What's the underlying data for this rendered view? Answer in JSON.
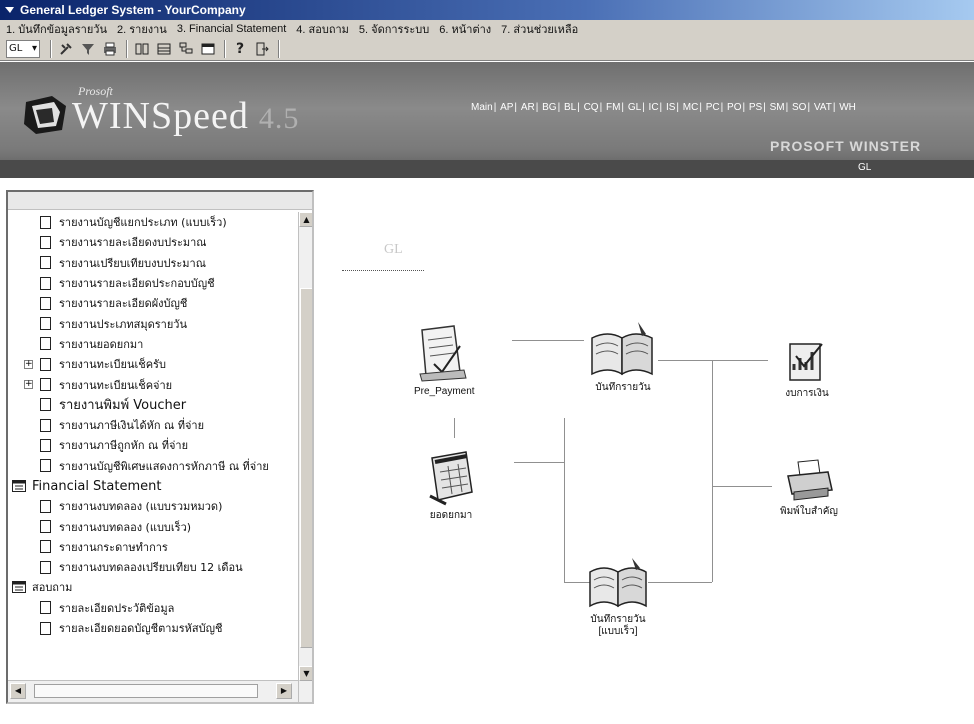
{
  "window": {
    "title": "General Ledger System - YourCompany"
  },
  "menu": [
    "1. บันทึกข้อมูลรายวัน",
    "2. รายงาน",
    "3. Financial Statement",
    "4. สอบถาม",
    "5. จัดการระบบ",
    "6. หน้าต่าง",
    "7. ส่วนช่วยเหลือ"
  ],
  "toolbar": {
    "module_value": "GL",
    "icons": [
      "tools-icon",
      "filter-icon",
      "print-icon",
      "columns-icon",
      "rows-icon",
      "tree-icon",
      "window-icon",
      "help-icon",
      "exit-icon"
    ]
  },
  "banner": {
    "brand_small": "Prosoft",
    "product": "WINSpeed",
    "version": "4.5",
    "modules": [
      "Main",
      "AP",
      "AR",
      "BG",
      "BL",
      "CQ",
      "FM",
      "GL",
      "IC",
      "IS",
      "MC",
      "PC",
      "PO",
      "PS",
      "SM",
      "SO",
      "VAT",
      "WH"
    ],
    "tagline": "PROSOFT WINSTER",
    "current_module": "GL"
  },
  "tree": {
    "items": [
      {
        "level": 2,
        "label": "รายงานบัญชีแยกประเภท (แบบเร็ว)"
      },
      {
        "level": 2,
        "label": "รายงานรายละเอียดงบประมาณ"
      },
      {
        "level": 2,
        "label": "รายงานเปรียบเทียบงบประมาณ"
      },
      {
        "level": 2,
        "label": "รายงานรายละเอียดประกอบบัญชี"
      },
      {
        "level": 2,
        "label": "รายงานรายละเอียดผังบัญชี"
      },
      {
        "level": 2,
        "label": "รายงานประเภทสมุดรายวัน"
      },
      {
        "level": 2,
        "label": "รายงานยอดยกมา"
      },
      {
        "level": 2,
        "label": "รายงานทะเบียนเช็ครับ",
        "expandable": true
      },
      {
        "level": 2,
        "label": "รายงานทะเบียนเช็คจ่าย",
        "expandable": true
      },
      {
        "level": 2,
        "label": "รายงานพิมพ์ Voucher"
      },
      {
        "level": 2,
        "label": "รายงานภาษีเงินได้หัก ณ ที่จ่าย"
      },
      {
        "level": 2,
        "label": "รายงานภาษีถูกหัก ณ ที่จ่าย"
      },
      {
        "level": 2,
        "label": "รายงานบัญชีพิเศษแสดงการหักภาษี ณ ที่จ่าย"
      },
      {
        "level": 1,
        "label": "Financial Statement",
        "big": true
      },
      {
        "level": 2,
        "label": "รายงานงบทดลอง (แบบรวมหมวด)"
      },
      {
        "level": 2,
        "label": "รายงานงบทดลอง (แบบเร็ว)"
      },
      {
        "level": 2,
        "label": "รายงานกระดาษทำการ"
      },
      {
        "level": 2,
        "label": "รายงานงบทดลองเปรียบเทียบ 12 เดือน"
      },
      {
        "level": 1,
        "label": "สอบถาม"
      },
      {
        "level": 2,
        "label": "รายละเอียดประวัติข้อมูล"
      },
      {
        "level": 2,
        "label": "รายละเอียดยอดบัญชีตามรหัสบัญชี"
      }
    ]
  },
  "flow": {
    "title": "GL",
    "nodes": [
      {
        "id": "pre_payment",
        "label": "Pre_Payment",
        "icon": "invoice-icon"
      },
      {
        "id": "daily_journal",
        "label": "บันทึกรายวัน",
        "icon": "book-icon"
      },
      {
        "id": "financial_statement",
        "label": "งบการเงิน",
        "icon": "chart-report-icon"
      },
      {
        "id": "brought_forward",
        "label": "ยอดยกมา",
        "icon": "calendar-icon"
      },
      {
        "id": "print_important",
        "label": "พิมพ์ใบสำคัญ",
        "icon": "printer-icon"
      },
      {
        "id": "daily_journal_fast",
        "label": "บันทึกรายวัน\n[แบบเร็ว]",
        "icon": "book-icon"
      }
    ]
  }
}
